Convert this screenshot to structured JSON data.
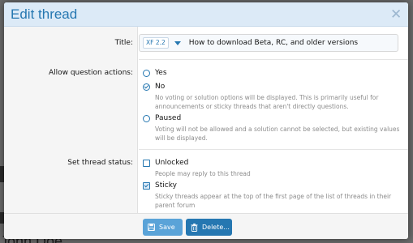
{
  "dialog": {
    "title": "Edit thread"
  },
  "title_field": {
    "label": "Title:",
    "prefix": "XF 2.2",
    "value": "How to download Beta, RC, and older versions"
  },
  "question_actions": {
    "label": "Allow question actions:",
    "options": [
      {
        "label": "Yes",
        "checked": false,
        "hint": ""
      },
      {
        "label": "No",
        "checked": true,
        "hint": "No voting or solution options will be displayed. This is primarily useful for announcements or sticky threads that aren't directly questions."
      },
      {
        "label": "Paused",
        "checked": false,
        "hint": "Voting will not be allowed and a solution cannot be selected, but existing values will be displayed."
      }
    ]
  },
  "thread_status": {
    "label": "Set thread status:",
    "options": [
      {
        "label": "Unlocked",
        "checked": false,
        "hint": "People may reply to this thread"
      },
      {
        "label": "Sticky",
        "checked": true,
        "hint": "Sticky threads appear at the top of the first page of the list of threads in their parent forum"
      }
    ]
  },
  "footer": {
    "save_label": "Save",
    "delete_label": "Delete..."
  },
  "background": {
    "name_text": "John Doe"
  },
  "colors": {
    "accent": "#2577b1",
    "header_bg": "#dceaf7",
    "save_button": "#5aa3d8",
    "hint_text": "#8c8c8c"
  }
}
